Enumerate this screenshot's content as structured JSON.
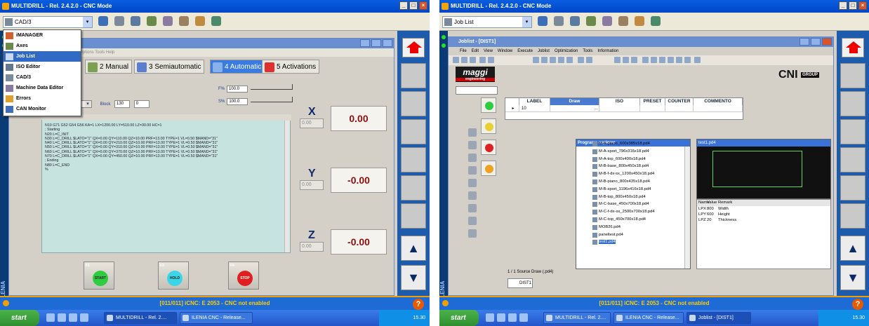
{
  "left": {
    "title": "MULTIDRILL - Rel. 2.4.2.0 - CNC Mode",
    "combo_value": "CAD/3",
    "dropdown": [
      {
        "label": "iMANAGER"
      },
      {
        "label": "Axes"
      },
      {
        "label": "Job List"
      },
      {
        "label": "ISO Editor"
      },
      {
        "label": "CAD/3"
      },
      {
        "label": "Machine Data Editor"
      },
      {
        "label": "Errors"
      },
      {
        "label": "CAN Monitor"
      }
    ],
    "menu": "Options  Tools  Help",
    "tabs": [
      {
        "label": "2 Manual"
      },
      {
        "label": "3 Semiautomatic"
      },
      {
        "label": "4 Automatic"
      },
      {
        "label": "5 Activations"
      }
    ],
    "program_number": "01200",
    "f_label": "F%",
    "f_value": "100.0",
    "s_label": "S%",
    "s_value": "100.0",
    "block_label": "Block",
    "block_value": "130",
    "block_value2": "0",
    "code_lines": [
      "N10 G71 G52 G54 G56 KA=1 LX=1200.00 LY=510.00 LZ=30.00 HC=1",
      "; Starting",
      "N20 L=C_INIT",
      "N30 L=C_DRILL $LATO=\"1\" QX=0.00 QY=110.00 QZ=10.00 PRF=13.00 TYPE=1 VL=0.50 $MAND=\"31\"",
      "N40 L=C_DRILL $LATO=\"1\" QX=0.00 QY=210.00 QZ=10.00 PRF=13.00 TYPE=1 VL=0.50 $MAND=\"31\"",
      "N50 L=C_DRILL $LATO=\"1\" QX=0.00 QY=310.00 QZ=10.00 PRF=13.00 TYPE=1 VL=0.50 $MAND=\"31\"",
      "N60 L=C_DRILL $LATO=\"1\" QX=0.00 QY=370.00 QZ=10.00 PRF=13.00 TYPE=1 VL=0.50 $MAND=\"31\"",
      "N70 L=C_DRILL $LATO=\"1\" QX=0.00 QY=450.00 QZ=10.00 PRF=13.00 TYPE=1 VL=0.50 $MAND=\"31\"",
      "; Ending",
      "N80 L=C_END",
      "%"
    ],
    "axes": [
      {
        "label": "X",
        "small": "0.00",
        "value": "0.00"
      },
      {
        "label": "Y",
        "small": "0.00",
        "value": "-0.00"
      },
      {
        "label": "Z",
        "small": "0.00",
        "value": "-0.00"
      }
    ],
    "buttons": [
      {
        "key": "F2",
        "label": "START",
        "color": "#2ecc40"
      },
      {
        "key": "F3",
        "label": "HOLD",
        "color": "#3ad6e8"
      },
      {
        "key": "F4",
        "label": "STOP",
        "color": "#e02020"
      }
    ],
    "brand": "ILENIA",
    "status": "[011/011] iCNC: E  2053 - CNC not enabled",
    "taskbar": {
      "start": "start",
      "tasks": [
        "MULTIDRILL - Rel. 2....",
        "ILENIA CNC - Release..."
      ],
      "clock": "15.30"
    }
  },
  "right": {
    "title": "MULTIDRILL - Rel. 2.4.2.0 - CNC Mode",
    "combo_value": "Job List",
    "win_title": "Joblist - [DIST1]",
    "menu": [
      "File",
      "Edit",
      "View",
      "Window",
      "Execute",
      "Joblist",
      "Optimization",
      "Tools",
      "Information"
    ],
    "maggi": "maggi",
    "maggi_sub": "engineering",
    "cni": "CNI",
    "cni_group": "GROUP",
    "grid_headers": [
      "LABEL",
      "Draw",
      "ISO",
      "PRESET",
      "COUNTER",
      "COMMENTO"
    ],
    "grid_row": {
      "label": "10",
      "draw": "..."
    },
    "explorer_title": "Programs explorer",
    "programs": [
      "M-A-piano_600x385x18.pd4",
      "M-A-sport_796x316x18.pd4",
      "M-A-top_600x400x18.pd4",
      "M-B-base_800x450x18.pd4",
      "M-B-f-dx-sx_1200x450x18.pd4",
      "M-B-piano_800x435x18.pd4",
      "M-B-sport_1196x416x18.pd4",
      "M-B-top_800x450x18.pd4",
      "M-C-base_450x700x18.pd4",
      "M-C-f-dx-sx_2500x700x18.pd4",
      "M-C-top_450x700x18.pd4",
      "MOB26.pd4",
      "paneltest.pd4",
      "test1.pd4"
    ],
    "preview_title": "test1.pd4",
    "param_headers": [
      "Name",
      "Value",
      "Remark"
    ],
    "params": [
      {
        "name": "LPX",
        "value": "800",
        "remark": "Width"
      },
      {
        "name": "LPY",
        "value": "600",
        "remark": "Height"
      },
      {
        "name": "LPZ",
        "value": "20",
        "remark": "Thickness"
      }
    ],
    "footer": "1 / 1  Source Draw (.pd4)",
    "doc_tab": "DIST1",
    "brand": "ILENIA",
    "status": "[011/011] iCNC: E  2053 - CNC not enabled",
    "taskbar": {
      "start": "start",
      "tasks": [
        "MULTIDRILL - Rel. 2....",
        "ILENIA CNC - Release...",
        "Joblist - [DIST1]"
      ],
      "clock": "15.30"
    }
  }
}
